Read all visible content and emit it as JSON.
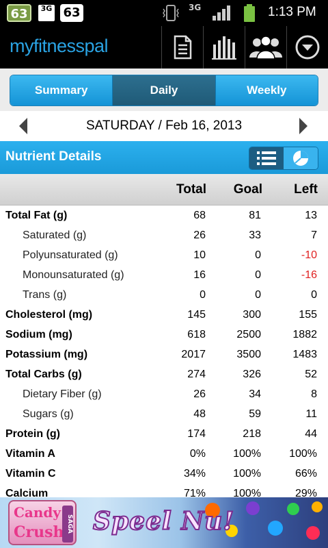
{
  "status_bar": {
    "notif1": "63",
    "notif2_label": "3G",
    "notif3": "63",
    "network": "3G",
    "time": "1:13 PM"
  },
  "app": {
    "logo": "myfitnesspal",
    "header_buttons": [
      "notes-icon",
      "chart-icon",
      "friends-icon",
      "menu-icon"
    ]
  },
  "tabs": [
    {
      "label": "Summary",
      "active": false
    },
    {
      "label": "Daily",
      "active": true
    },
    {
      "label": "Weekly",
      "active": false
    }
  ],
  "date": "SATURDAY / Feb 16, 2013",
  "nutrient_section": {
    "title": "Nutrient Details"
  },
  "columns": {
    "total": "Total",
    "goal": "Goal",
    "left": "Left"
  },
  "nutrients": [
    {
      "name": "Total Fat (g)",
      "level": "main",
      "total": "68",
      "goal": "81",
      "left": "13",
      "negative": false
    },
    {
      "name": "Saturated (g)",
      "level": "sub",
      "total": "26",
      "goal": "33",
      "left": "7",
      "negative": false
    },
    {
      "name": "Polyunsaturated (g)",
      "level": "sub",
      "total": "10",
      "goal": "0",
      "left": "-10",
      "negative": true
    },
    {
      "name": "Monounsaturated (g)",
      "level": "sub",
      "total": "16",
      "goal": "0",
      "left": "-16",
      "negative": true
    },
    {
      "name": "Trans (g)",
      "level": "sub",
      "total": "0",
      "goal": "0",
      "left": "0",
      "negative": false
    },
    {
      "name": "Cholesterol (mg)",
      "level": "main",
      "total": "145",
      "goal": "300",
      "left": "155",
      "negative": false
    },
    {
      "name": "Sodium (mg)",
      "level": "main",
      "total": "618",
      "goal": "2500",
      "left": "1882",
      "negative": false
    },
    {
      "name": "Potassium (mg)",
      "level": "main",
      "total": "2017",
      "goal": "3500",
      "left": "1483",
      "negative": false
    },
    {
      "name": "Total Carbs (g)",
      "level": "main",
      "total": "274",
      "goal": "326",
      "left": "52",
      "negative": false
    },
    {
      "name": "Dietary Fiber (g)",
      "level": "sub",
      "total": "26",
      "goal": "34",
      "left": "8",
      "negative": false
    },
    {
      "name": "Sugars (g)",
      "level": "sub",
      "total": "48",
      "goal": "59",
      "left": "11",
      "negative": false
    },
    {
      "name": "Protein (g)",
      "level": "main",
      "total": "174",
      "goal": "218",
      "left": "44",
      "negative": false
    },
    {
      "name": "Vitamin A",
      "level": "main",
      "total": "0%",
      "goal": "100%",
      "left": "100%",
      "negative": false
    },
    {
      "name": "Vitamin C",
      "level": "main",
      "total": "34%",
      "goal": "100%",
      "left": "66%",
      "negative": false
    },
    {
      "name": "Calcium",
      "level": "main",
      "total": "71%",
      "goal": "100%",
      "left": "29%",
      "negative": false
    }
  ],
  "ad": {
    "brand_line1": "Candy",
    "brand_line2": "Crush",
    "brand_tag": "SAGA",
    "cta": "Speel Nu!"
  },
  "colors": {
    "accent": "#1a9ad9",
    "negative": "#e02020",
    "logo": "#2aa3e3"
  }
}
